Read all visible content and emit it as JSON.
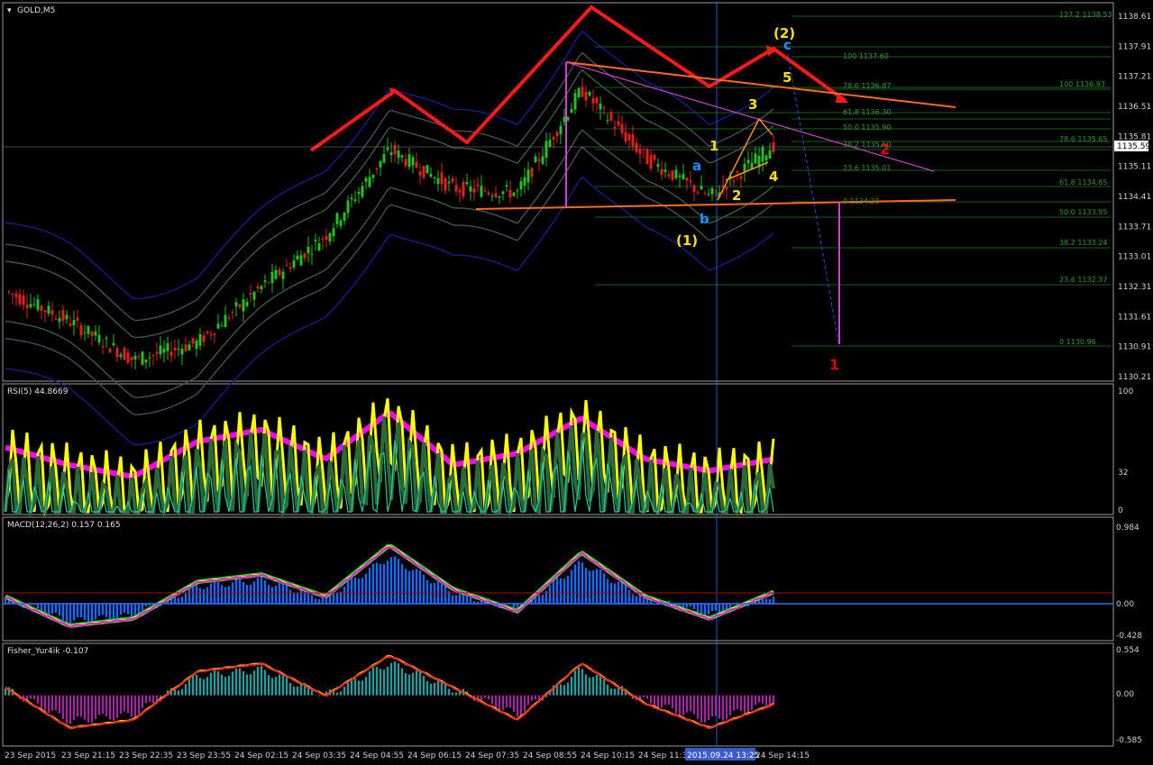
{
  "window": {
    "title": "GOLD,M5",
    "menu_glyph": "▾"
  },
  "price_axis": [
    "1138.61",
    "1137.91",
    "1137.21",
    "1136.51",
    "1135.81",
    "1135.11",
    "1134.41",
    "1133.71",
    "1133.01",
    "1132.31",
    "1131.61",
    "1130.91",
    "1130.21"
  ],
  "current_price": "1135.59",
  "fib_levels": [
    {
      "text": "127.2 1138.53",
      "row": "right"
    },
    {
      "text": "100 1137.60",
      "row": "mid"
    },
    {
      "text": "100 1136.93",
      "row": "right"
    },
    {
      "text": "78.6 1136.87",
      "row": "mid"
    },
    {
      "text": "61.8 1136.30",
      "row": "mid"
    },
    {
      "text": "50.0 1135.90",
      "row": "mid"
    },
    {
      "text": "38.2 1135.50",
      "row": "mid"
    },
    {
      "text": "78.6 1135.65",
      "row": "right"
    },
    {
      "text": "23.6 1135.01",
      "row": "mid"
    },
    {
      "text": "61.8 1134.65",
      "row": "right"
    },
    {
      "text": "0 1134.21",
      "row": "mid"
    },
    {
      "text": "50.0 1133.95",
      "row": "right"
    },
    {
      "text": "38.2 1133.24",
      "row": "right"
    },
    {
      "text": "23.6 1132.37",
      "row": "right"
    },
    {
      "text": "0 1130.96",
      "row": "right"
    }
  ],
  "wave_labels": {
    "paren2": "(2)",
    "paren1": "(1)",
    "c": "c",
    "a": "a",
    "b": "b",
    "w1": "1",
    "w2": "2",
    "w3": "3",
    "w4": "4",
    "w5": "5",
    "red1": "1",
    "red2": "2"
  },
  "panels": {
    "rsi": {
      "title": "RSI(5) 44.8669",
      "axis": [
        "100",
        "32",
        "0"
      ]
    },
    "macd": {
      "title": "MACD(12,26,2) 0.157 0.165",
      "axis": [
        "0.984",
        "0.00",
        "-0.428"
      ]
    },
    "fisher": {
      "title": "Fisher_Yur4ik -0.107",
      "axis": [
        "0.554",
        "0.00",
        "-0.585"
      ]
    }
  },
  "time_axis": [
    "23 Sep 2015",
    "23 Sep 21:15",
    "23 Sep 22:35",
    "23 Sep 23:55",
    "24 Sep 02:15",
    "24 Sep 03:35",
    "24 Sep 04:55",
    "24 Sep 06:15",
    "24 Sep 07:35",
    "24 Sep 08:55",
    "24 Sep 10:15",
    "24 Sep 11:35",
    "24 Sep 14:15"
  ],
  "time_cursor": "2015.09.24 13:25",
  "colors": {
    "bull": "#22c022",
    "bear": "#e02020",
    "rsi": "#ffff00",
    "rsi_glow": "#ff00ff",
    "fib": "#2a9a2a",
    "orange": "#ff6a1a",
    "red": "#ff1a1a",
    "blue": "#1a1aa0",
    "magenta": "#cc44cc"
  },
  "chart_data": {
    "type": "line",
    "symbol": "GOLD",
    "timeframe": "M5",
    "x": [
      "23 Sep 2015",
      "23 Sep 21:15",
      "23 Sep 22:35",
      "23 Sep 23:55",
      "24 Sep 02:15",
      "24 Sep 03:35",
      "24 Sep 04:55",
      "24 Sep 06:15",
      "24 Sep 07:35",
      "24 Sep 08:55",
      "24 Sep 10:15",
      "24 Sep 11:35",
      "24 Sep 14:15"
    ],
    "ylim": [
      1130.21,
      1138.61
    ],
    "series": [
      {
        "name": "",
        "values": [
          1132.2,
          1131.5,
          1130.6,
          1131.0,
          1132.3,
          1133.5,
          1135.5,
          1134.6,
          1134.5,
          1136.9,
          1135.3,
          1134.4,
          1135.6
        ]
      }
    ],
    "subpanels": [
      {
        "type": "line",
        "title": "RSI(5) 44.8669",
        "ylim": [
          0,
          100
        ],
        "series": [
          {
            "name": "",
            "values": [
              55,
              40,
              30,
              60,
              70,
              45,
              85,
              40,
              50,
              80,
              45,
              35,
              45
            ]
          }
        ]
      },
      {
        "type": "bar",
        "title": "MACD(12,26,2) 0.157 0.165",
        "ylim": [
          -0.428,
          0.984
        ],
        "series": [
          {
            "name": "",
            "values": [
              0.1,
              -0.3,
              -0.2,
              0.3,
              0.4,
              0.1,
              0.8,
              0.2,
              -0.1,
              0.7,
              0.1,
              -0.2,
              0.16
            ]
          }
        ]
      },
      {
        "type": "bar",
        "title": "Fisher_Yur4ik -0.107",
        "ylim": [
          -0.585,
          0.554
        ],
        "series": [
          {
            "name": "",
            "values": [
              0.1,
              -0.4,
              -0.3,
              0.3,
              0.4,
              0.0,
              0.5,
              0.1,
              -0.3,
              0.4,
              -0.1,
              -0.4,
              -0.107
            ]
          }
        ]
      }
    ]
  }
}
